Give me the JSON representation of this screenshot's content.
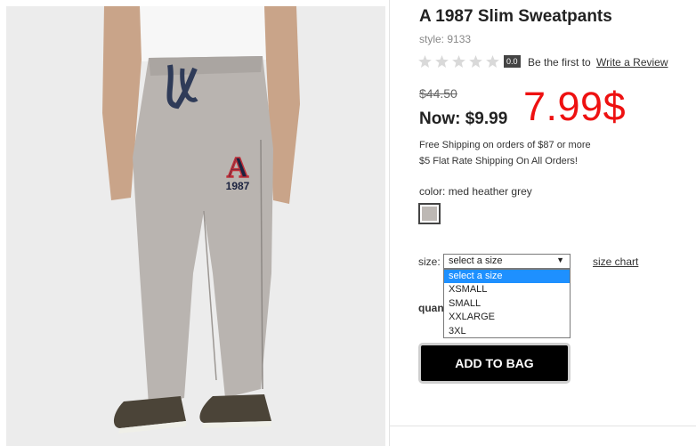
{
  "product": {
    "title": "A 1987 Slim Sweatpants",
    "style_label": "style:",
    "style_number": "9133",
    "image_alt_label": "A",
    "image_year": "1987"
  },
  "rating": {
    "stars_filled": 0,
    "stars_total": 5,
    "score": "0.0",
    "review_prompt": "Be the first to",
    "review_link": "Write a Review"
  },
  "pricing": {
    "old_price": "$44.50",
    "now_label": "Now:",
    "now_price": "$9.99",
    "promo_price": "7.99$"
  },
  "shipping": {
    "line1": "Free Shipping on orders of $87 or more",
    "line2": "$5 Flat Rate Shipping On All Orders!"
  },
  "color": {
    "label": "color:",
    "value": "med heather grey",
    "swatch_hex": "#bdb8b4"
  },
  "size": {
    "label": "size:",
    "selected": "select a size",
    "chart_link": "size chart",
    "options": [
      "select a size",
      "XSMALL",
      "SMALL",
      "XXLARGE",
      "3XL"
    ]
  },
  "quantity": {
    "label": "quantity"
  },
  "cart": {
    "add_button": "ADD TO BAG"
  },
  "colors": {
    "promo_red": "#ee1111",
    "highlight_blue": "#1e90ff",
    "button_black": "#000000"
  }
}
